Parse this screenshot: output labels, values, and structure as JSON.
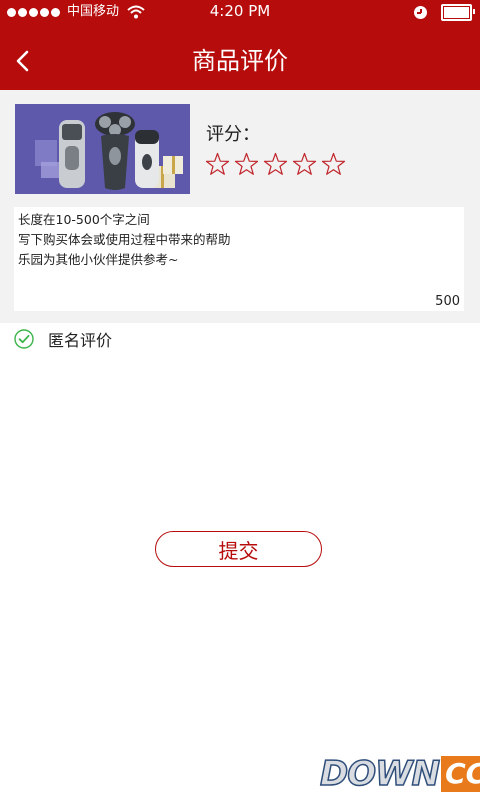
{
  "status_bar": {
    "carrier": "中国移动",
    "time": "4:20 PM"
  },
  "nav": {
    "title": "商品评价",
    "back_icon": "chevron-left-icon"
  },
  "product": {
    "image_icon": "electric-shaver-product-image",
    "rating_label": "评分：",
    "rating_value": 0,
    "rating_max": 5,
    "star_icon": "star-outline-icon"
  },
  "review": {
    "placeholder": "长度在10-500个字之间\n写下购买体会或使用过程中带来的帮助\n乐园为其他小伙伴提供参考~",
    "char_limit": "500"
  },
  "anonymous": {
    "label": "匿名评价",
    "checked": true,
    "icon": "check-circle-icon"
  },
  "submit": {
    "label": "提交"
  },
  "watermark": {
    "text_main": "DOWN",
    "text_suffix": "CC"
  },
  "colors": {
    "brand": "#b60c0c",
    "panel_bg": "#f2f2f2",
    "check_green": "#3cb44a",
    "watermark_orange": "#e87a1c"
  }
}
